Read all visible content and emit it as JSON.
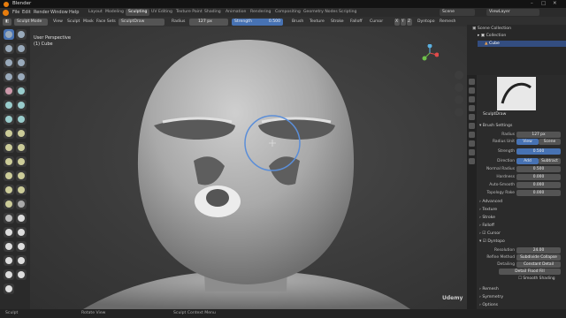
{
  "window": {
    "title": "Blender"
  },
  "menus": [
    "File",
    "Edit",
    "Render",
    "Window",
    "Help"
  ],
  "workspaces": [
    "Layout",
    "Modeling",
    "Sculpting",
    "UV Editing",
    "Texture Paint",
    "Shading",
    "Animation",
    "Rendering",
    "Compositing",
    "Geometry Nodes",
    "Scripting"
  ],
  "active_workspace": "Sculpting",
  "scene": "Scene",
  "view_layer": "ViewLayer",
  "header": {
    "mode": "Sculpt Mode",
    "view": "View",
    "sculpt": "Sculpt",
    "mask": "Mask",
    "face_sets": "Face Sets",
    "brush_name": "SculptDraw",
    "radius_label": "Radius",
    "radius_value": "127 px",
    "strength_label": "Strength",
    "strength_value": "0.500",
    "brush": "Brush",
    "texture": "Texture",
    "stroke": "Stroke",
    "falloff": "Falloff",
    "cursor": "Cursor",
    "dyntopo": "Dyntopo",
    "remesh": "Remesh",
    "options": "Options",
    "axes": [
      "X",
      "Y",
      "Z"
    ]
  },
  "viewport": {
    "view_name": "User Perspective",
    "object": "(1) Cube"
  },
  "outliner": {
    "root": "Scene Collection",
    "collection": "Collection",
    "object": "Cube"
  },
  "properties": {
    "brush_name": "SculptDraw",
    "brush_settings": "Brush Settings",
    "radius_label": "Radius",
    "radius": "127 px",
    "radius_unit_label": "Radius Unit",
    "view": "View",
    "scene": "Scene",
    "strength_label": "Strength",
    "strength": "0.500",
    "direction_label": "Direction",
    "add": "Add",
    "subtract": "Subtract",
    "normal_radius_label": "Normal Radius",
    "normal_radius": "0.500",
    "hardness_label": "Hardness",
    "hardness": "0.000",
    "auto_smooth_label": "Auto-Smooth",
    "auto_smooth": "0.000",
    "topology_rake_label": "Topology Rake",
    "topology_rake": "0.000",
    "sections": [
      "Advanced",
      "Texture",
      "Stroke",
      "Falloff",
      "Cursor"
    ],
    "dyntopo": "Dyntopo",
    "resolution_label": "Resolution",
    "resolution": "24.00",
    "refine_label": "Refine Method",
    "refine": "Subdivide Collapse",
    "detailing_label": "Detailing",
    "detailing": "Constant Detail",
    "flood_fill": "Detail Flood Fill",
    "smooth_shading": "Smooth Shading",
    "remesh": "Remesh",
    "symmetry": "Symmetry",
    "options": "Options"
  },
  "status": {
    "sculpt": "Sculpt",
    "rotate": "Rotate View",
    "menu": "Sculpt Context Menu"
  },
  "watermark": "Udemy"
}
